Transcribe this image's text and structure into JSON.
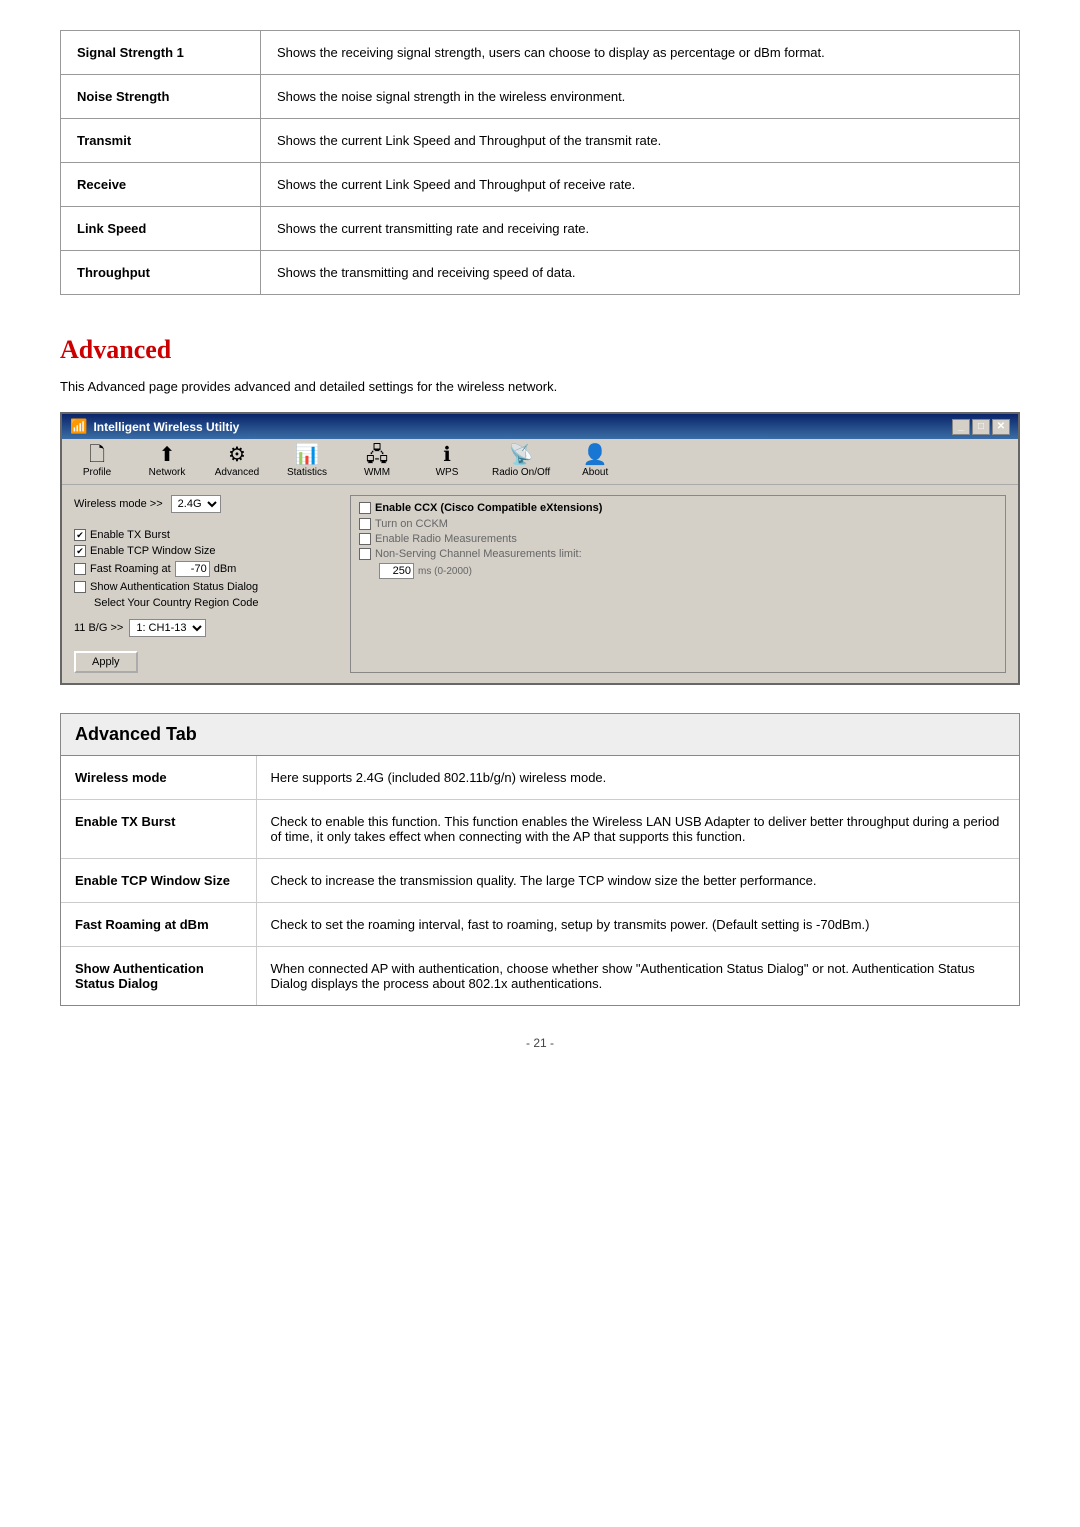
{
  "top_table": {
    "rows": [
      {
        "label": "Signal Strength 1",
        "description": "Shows the receiving signal strength, users can choose to display as percentage or dBm format."
      },
      {
        "label": "Noise Strength",
        "description": "Shows the noise signal strength in the wireless environment."
      },
      {
        "label": "Transmit",
        "description": "Shows the current Link Speed and Throughput of the transmit rate."
      },
      {
        "label": "Receive",
        "description": "Shows the current Link Speed and Throughput of receive rate."
      },
      {
        "label": "Link Speed",
        "description": "Shows the current transmitting rate and receiving rate."
      },
      {
        "label": "Throughput",
        "description": "Shows the transmitting and receiving speed of data."
      }
    ]
  },
  "advanced_section": {
    "heading": "Advanced",
    "description": "This Advanced page provides advanced and detailed settings for the wireless network."
  },
  "app_window": {
    "title": "Intelligent Wireless Utiltiy",
    "close_btn": "✕",
    "toolbar_items": [
      {
        "icon": "🗋",
        "label": "Profile"
      },
      {
        "icon": "⬆",
        "label": "Network"
      },
      {
        "icon": "⚙",
        "label": "Advanced"
      },
      {
        "icon": "📊",
        "label": "Statistics"
      },
      {
        "icon": "🖧",
        "label": "WMM"
      },
      {
        "icon": "ℹ",
        "label": "WPS"
      },
      {
        "icon": "📡",
        "label": "Radio On/Off"
      },
      {
        "icon": "👤",
        "label": "About"
      }
    ],
    "wireless_mode_label": "Wireless mode >>",
    "wireless_mode_value": "2.4G",
    "checkboxes": [
      {
        "label": "Enable TX Burst",
        "checked": true
      },
      {
        "label": "Enable TCP Window Size",
        "checked": true
      },
      {
        "label": "Fast Roaming at",
        "checked": false
      },
      {
        "label": "Show Authentication Status Dialog",
        "checked": false
      },
      {
        "label": "Select Your Country Region Code",
        "checked": false,
        "indent": true
      }
    ],
    "fast_roaming_value": "-70",
    "fast_roaming_unit": "dBm",
    "ccx_label": "Enable CCX (Cisco Compatible eXtensions)",
    "ccx_items": [
      "Turn on CCKM",
      "Enable Radio Measurements",
      "Non-Serving Channel Measurements limit:"
    ],
    "ms_value": "250",
    "ms_range": "ms (0-2000)",
    "band_label": "11 B/G >>",
    "band_value": "1: CH1-13",
    "apply_label": "Apply"
  },
  "adv_tab": {
    "heading": "Advanced Tab",
    "rows": [
      {
        "label": "Wireless mode",
        "description": "Here supports 2.4G (included 802.11b/g/n) wireless mode."
      },
      {
        "label": "Enable TX Burst",
        "description": "Check to enable this function. This function enables the Wireless LAN USB Adapter to deliver better throughput during a period of time, it only takes effect when connecting with the AP that supports this function."
      },
      {
        "label": "Enable TCP Window Size",
        "description": "Check to increase the transmission quality. The large TCP window size the better performance."
      },
      {
        "label": "Fast Roaming at dBm",
        "description": "Check to set the roaming interval, fast to roaming, setup by transmits power. (Default setting is -70dBm.)"
      },
      {
        "label": "Show Authentication Status Dialog",
        "description": "When connected AP with authentication, choose whether show \"Authentication Status Dialog\" or not. Authentication Status Dialog displays the process about 802.1x authentications."
      }
    ]
  },
  "page_number": "- 21 -"
}
